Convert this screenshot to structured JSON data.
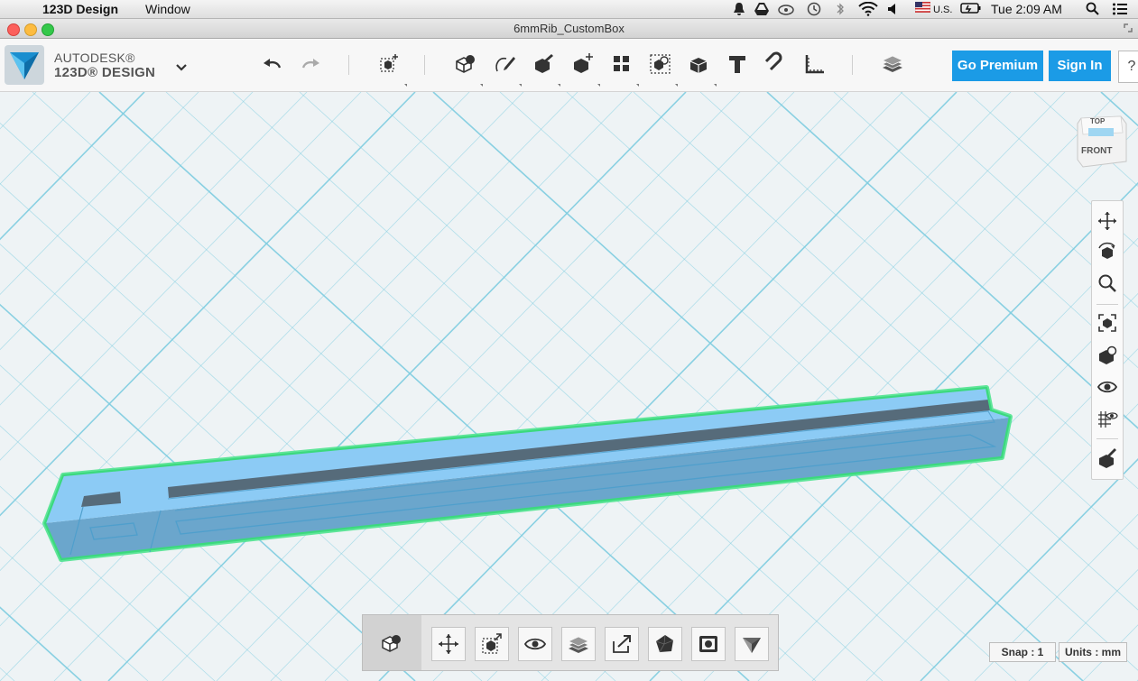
{
  "menubar": {
    "app_name": "123D Design",
    "menu_window": "Window",
    "keyboard": "U.S.",
    "clock": "Tue 2:09 AM"
  },
  "window": {
    "title": "6mmRib_CustomBox"
  },
  "brand": {
    "line1": "AUTODESK®",
    "line2": "123D® DESIGN"
  },
  "toolbar": {
    "go_premium": "Go Premium",
    "sign_in": "Sign In",
    "help": "?"
  },
  "viewcube": {
    "top": "TOP",
    "front": "FRONT"
  },
  "status": {
    "snap": "Snap : 1",
    "units": "Units : mm"
  },
  "colors": {
    "accent": "#1b9be6",
    "model_fill": "#8ccbf5",
    "selection_outline": "#4fe38f",
    "grid_line": "#7fcde0"
  }
}
